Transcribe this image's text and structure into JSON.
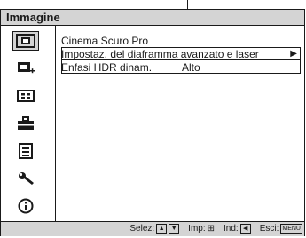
{
  "menu": {
    "title": "Immagine"
  },
  "sidebar": {
    "items": [
      {
        "icon": "picture-icon",
        "selected": true
      },
      {
        "icon": "picture-plus-icon",
        "selected": false
      },
      {
        "icon": "screen-icon",
        "selected": false
      },
      {
        "icon": "toolbox-icon",
        "selected": false
      },
      {
        "icon": "list-icon",
        "selected": false
      },
      {
        "icon": "wrench-icon",
        "selected": false
      },
      {
        "icon": "info-icon",
        "selected": false
      }
    ]
  },
  "content": {
    "items": [
      {
        "label": "Cinema Scuro Pro",
        "value": ""
      },
      {
        "label": "Impostaz. del diaframma avanzato e laser",
        "value": "",
        "has_submenu": true
      },
      {
        "label": "Enfasi HDR dinam.",
        "value": "Alto"
      }
    ],
    "submenu_arrow": "▶"
  },
  "footer": {
    "select_label": "Selez:",
    "select_keys": [
      "▲",
      "▼"
    ],
    "imp_label": "Imp:",
    "imp_key": "⊞",
    "ind_label": "Ind:",
    "ind_key": "◀",
    "exit_label": "Esci:",
    "exit_key": "MENU"
  }
}
